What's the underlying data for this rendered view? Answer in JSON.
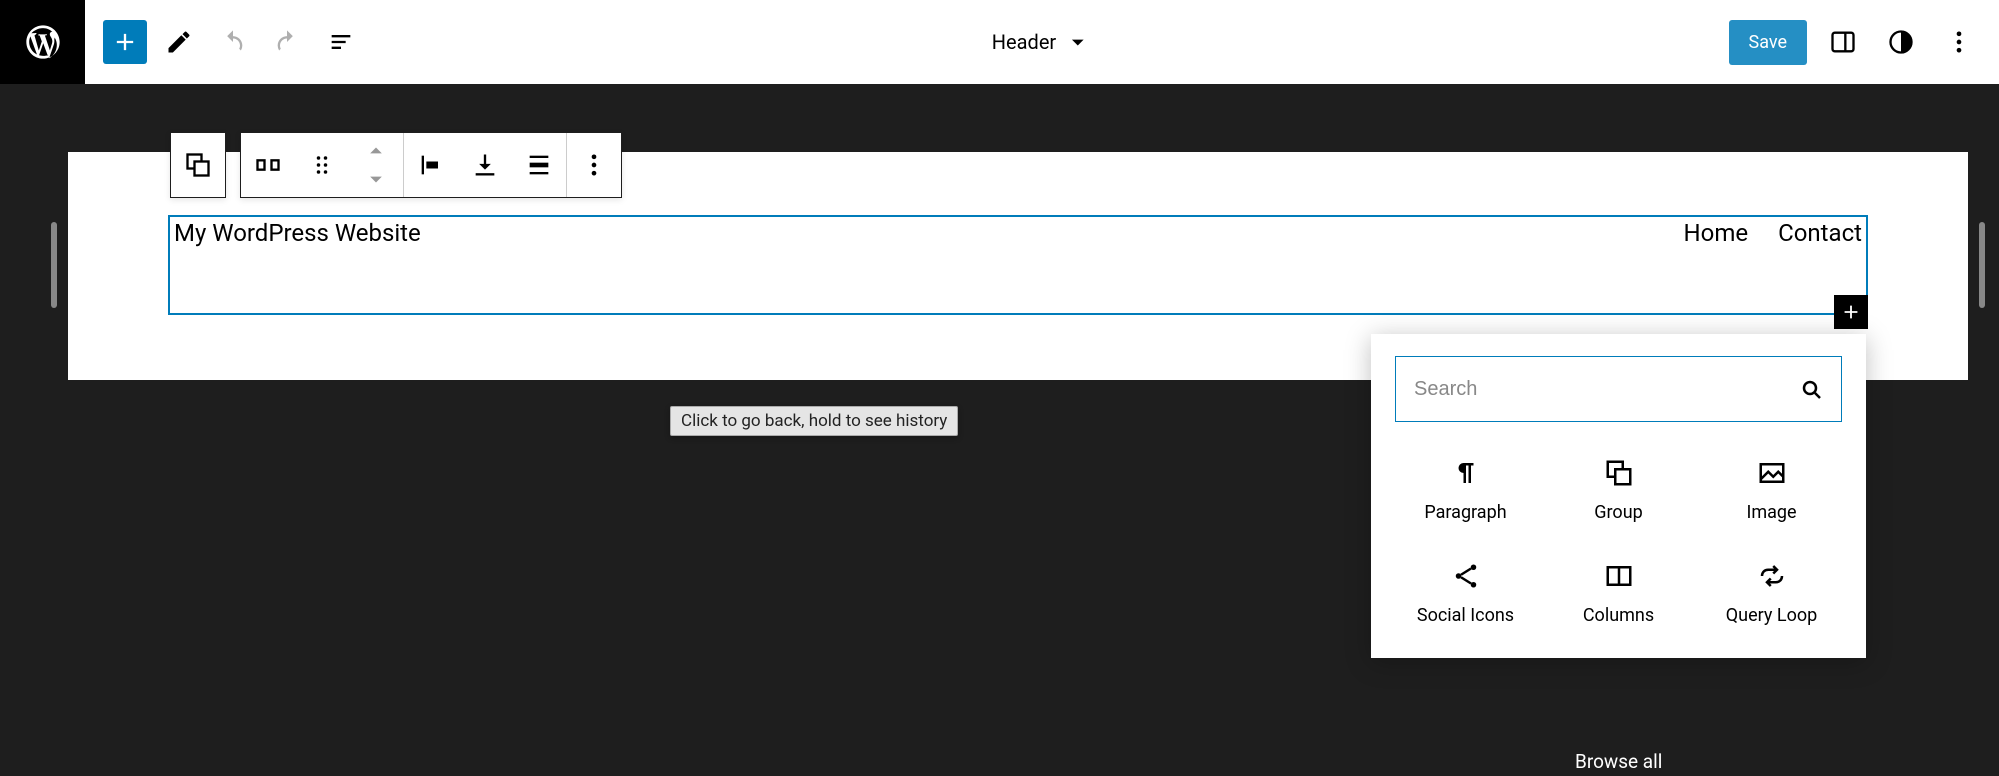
{
  "topbar": {
    "template_label": "Header",
    "save_label": "Save"
  },
  "header": {
    "site_title": "My WordPress Website",
    "nav": [
      "Home",
      "Contact"
    ]
  },
  "tooltip": {
    "text": "Click to go back, hold to see history"
  },
  "inserter": {
    "search_placeholder": "Search",
    "blocks": [
      {
        "id": "paragraph",
        "label": "Paragraph"
      },
      {
        "id": "group",
        "label": "Group"
      },
      {
        "id": "image",
        "label": "Image"
      },
      {
        "id": "social-icons",
        "label": "Social Icons"
      },
      {
        "id": "columns",
        "label": "Columns"
      },
      {
        "id": "query-loop",
        "label": "Query Loop"
      }
    ],
    "browse_all_label": "Browse all"
  }
}
